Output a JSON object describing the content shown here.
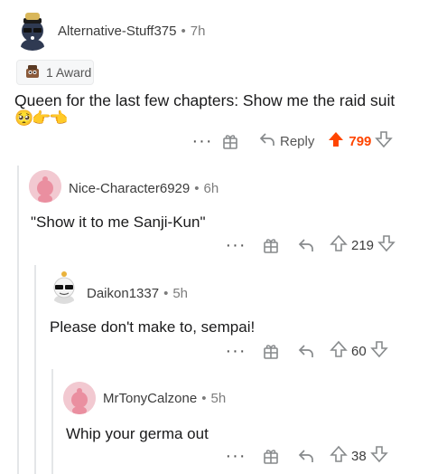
{
  "comments": [
    {
      "username": "Alternative-Stuff375",
      "age": "7h",
      "award": "1 Award",
      "text": "Queen for the last few chapters: Show me the raid suit",
      "emoji": "🥺👉👈",
      "reply_label": "Reply",
      "score": "799",
      "icons": [
        "more-icon",
        "award-icon",
        "reply-icon",
        "upvote-icon",
        "downvote-icon"
      ],
      "upvoted": true
    },
    {
      "username": "Nice-Character6929",
      "age": "6h",
      "text": "\"Show it to me Sanji-Kun\"",
      "score": "219"
    },
    {
      "username": "Daikon1337",
      "age": "5h",
      "text": "Please don't make to, sempai!",
      "score": "60"
    },
    {
      "username": "MrTonyCalzone",
      "age": "5h",
      "text": "Whip your germa out",
      "score": "38"
    }
  ],
  "colors": {
    "upvote": "#ff4500",
    "avatar_pink": "#ea8fa0",
    "thread": "#e4e6e8"
  }
}
